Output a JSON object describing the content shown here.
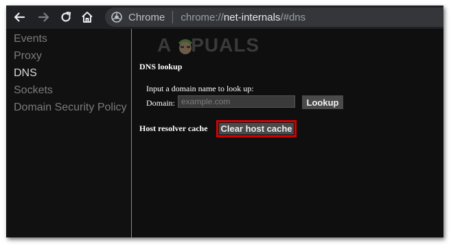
{
  "toolbar": {
    "back_icon": "arrow-left-icon",
    "forward_icon": "arrow-right-icon",
    "reload_icon": "reload-icon",
    "home_icon": "home-icon",
    "site_chip": "Chrome",
    "url_scheme": "chrome://",
    "url_host": "net-internals",
    "url_path": "/#dns"
  },
  "sidebar": {
    "items": [
      {
        "label": "Events"
      },
      {
        "label": "Proxy"
      },
      {
        "label": "DNS",
        "active": true
      },
      {
        "label": "Sockets"
      },
      {
        "label": "Domain Security Policy"
      }
    ]
  },
  "main": {
    "dns_lookup_title": "DNS lookup",
    "prompt": "Input a domain name to look up:",
    "domain_label": "Domain:",
    "domain_placeholder": "example.com",
    "lookup_button": "Lookup",
    "host_cache_label": "Host resolver cache",
    "clear_cache_button": "Clear host cache"
  },
  "watermark": "APPUALS",
  "colors": {
    "highlight": "#d40000",
    "background": "#0f0f0f",
    "toolbar": "#202124"
  }
}
